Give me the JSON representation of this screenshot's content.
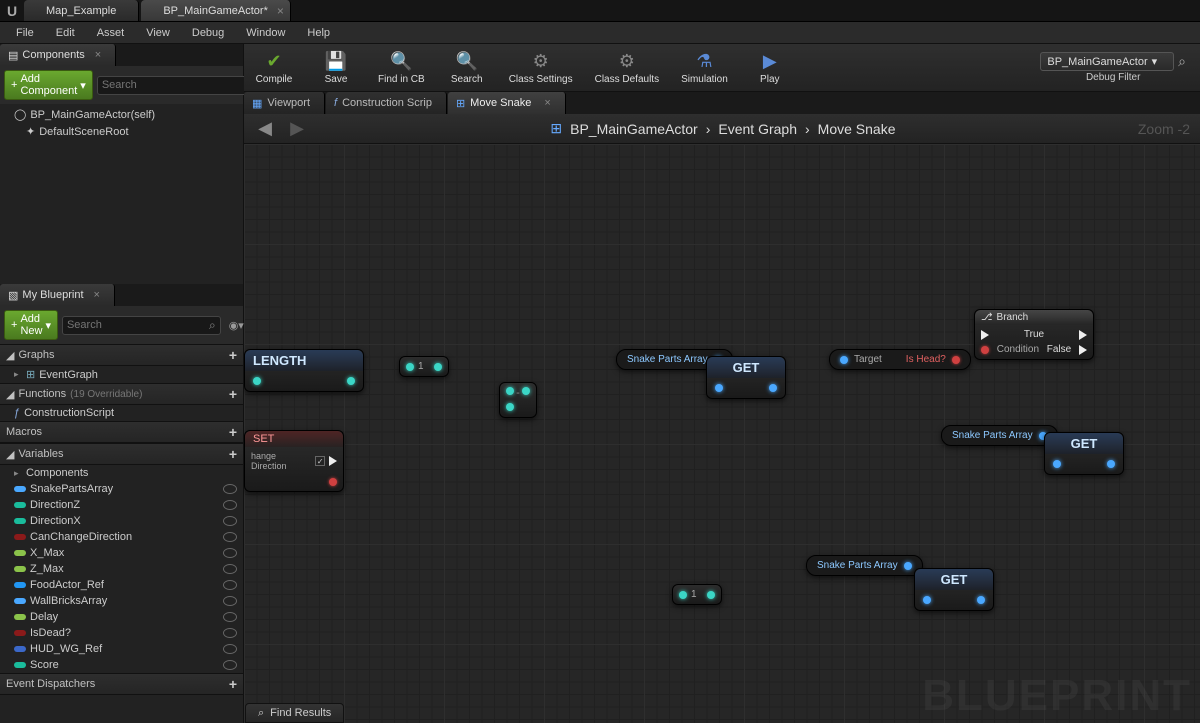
{
  "topTabs": [
    {
      "label": "Map_Example",
      "active": false
    },
    {
      "label": "BP_MainGameActor*",
      "active": true
    }
  ],
  "menu": [
    "File",
    "Edit",
    "Asset",
    "View",
    "Debug",
    "Window",
    "Help"
  ],
  "componentsPanel": {
    "tab": "Components",
    "addButton": "Add Component",
    "searchPlaceholder": "Search",
    "items": [
      "BP_MainGameActor(self)",
      "DefaultSceneRoot"
    ]
  },
  "myBlueprint": {
    "tab": "My Blueprint",
    "addButton": "Add New",
    "searchPlaceholder": "Search",
    "sections": {
      "graphs": {
        "label": "Graphs",
        "items": [
          "EventGraph"
        ]
      },
      "functions": {
        "label": "Functions",
        "hint": "(19 Overridable)",
        "items": [
          "ConstructionScript"
        ]
      },
      "macros": {
        "label": "Macros",
        "items": []
      },
      "variables": {
        "label": "Variables",
        "subLabel": "Components",
        "items": [
          {
            "name": "SnakePartsArray",
            "color": "#4aa8ff"
          },
          {
            "name": "DirectionZ",
            "color": "#1abc9c"
          },
          {
            "name": "DirectionX",
            "color": "#1abc9c"
          },
          {
            "name": "CanChangeDirection",
            "color": "#8b1a1a"
          },
          {
            "name": "X_Max",
            "color": "#8bc34a"
          },
          {
            "name": "Z_Max",
            "color": "#8bc34a"
          },
          {
            "name": "FoodActor_Ref",
            "color": "#2196f3"
          },
          {
            "name": "WallBricksArray",
            "color": "#4aa8ff"
          },
          {
            "name": "Delay",
            "color": "#8bc34a"
          },
          {
            "name": "IsDead?",
            "color": "#8b1a1a"
          },
          {
            "name": "HUD_WG_Ref",
            "color": "#3b68c9"
          },
          {
            "name": "Score",
            "color": "#1abc9c"
          }
        ]
      },
      "dispatchers": {
        "label": "Event Dispatchers"
      }
    }
  },
  "toolbar": {
    "buttons": [
      {
        "id": "compile",
        "label": "Compile",
        "glyph": "✔",
        "color": "#6aa82f"
      },
      {
        "id": "save",
        "label": "Save",
        "glyph": "💾",
        "color": "#b88a40"
      },
      {
        "id": "findincb",
        "label": "Find in CB",
        "glyph": "🔍",
        "color": "#b88a40"
      },
      {
        "id": "search",
        "label": "Search",
        "glyph": "🔍",
        "color": "#888"
      },
      {
        "id": "classsettings",
        "label": "Class Settings",
        "glyph": "⚙",
        "color": "#888"
      },
      {
        "id": "classdefaults",
        "label": "Class Defaults",
        "glyph": "⚙",
        "color": "#888"
      },
      {
        "id": "simulation",
        "label": "Simulation",
        "glyph": "⚗",
        "color": "#5a8ad6"
      },
      {
        "id": "play",
        "label": "Play",
        "glyph": "▶",
        "color": "#5a8ad6"
      }
    ],
    "debugLabel": "Debug Filter",
    "debugValue": "BP_MainGameActor"
  },
  "editorTabs": [
    {
      "label": "Viewport",
      "active": false
    },
    {
      "label": "Construction Scrip",
      "active": false
    },
    {
      "label": "Move Snake",
      "active": true
    }
  ],
  "breadcrumb": {
    "root": "BP_MainGameActor",
    "graph": "Event Graph",
    "func": "Move Snake",
    "zoom": "Zoom -2"
  },
  "watermark": "BLUEPRINT",
  "findResults": "Find Results",
  "nodes": {
    "length": "LENGTH",
    "get": "GET",
    "set": "SET",
    "branch": "Branch",
    "branchCond": "Condition",
    "branchTrue": "True",
    "branchFalse": "False",
    "snakeParts": "Snake Parts Array",
    "target": "Target",
    "isHead": "Is Head?",
    "changeDir": "hange Direction",
    "one": "1"
  }
}
